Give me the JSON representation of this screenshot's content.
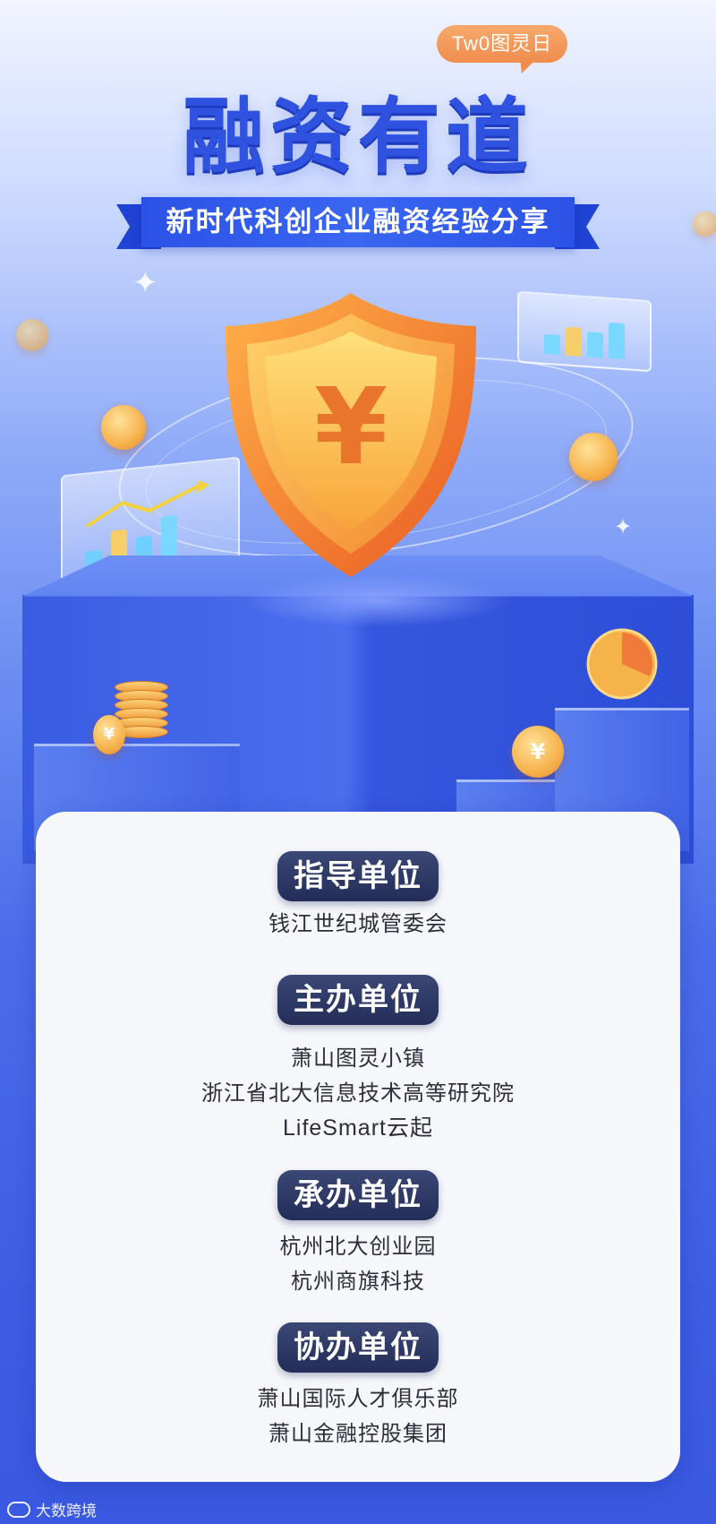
{
  "badge": {
    "text": "Tw0图灵日"
  },
  "title": "融资有道",
  "subtitle": "新时代科创企业融资经验分享",
  "coin_symbol": "¥",
  "sections": [
    {
      "label": "指导单位",
      "lines": [
        "钱江世纪城管委会"
      ]
    },
    {
      "label": "主办单位",
      "lines": [
        "萧山图灵小镇",
        "浙江省北大信息技术高等研究院",
        "LifeSmart云起"
      ]
    },
    {
      "label": "承办单位",
      "lines": [
        "杭州北大创业园",
        "杭州商旗科技"
      ]
    },
    {
      "label": "协办单位",
      "lines": [
        "萧山国际人才俱乐部",
        "萧山金融控股集团"
      ]
    }
  ],
  "watermark": {
    "text": "大数跨境"
  },
  "colors": {
    "title_blue": "#2f52e0",
    "badge_orange": "#ef8d4e",
    "pill_navy": "#2a3463",
    "card_bg": "#f6f7fb"
  }
}
